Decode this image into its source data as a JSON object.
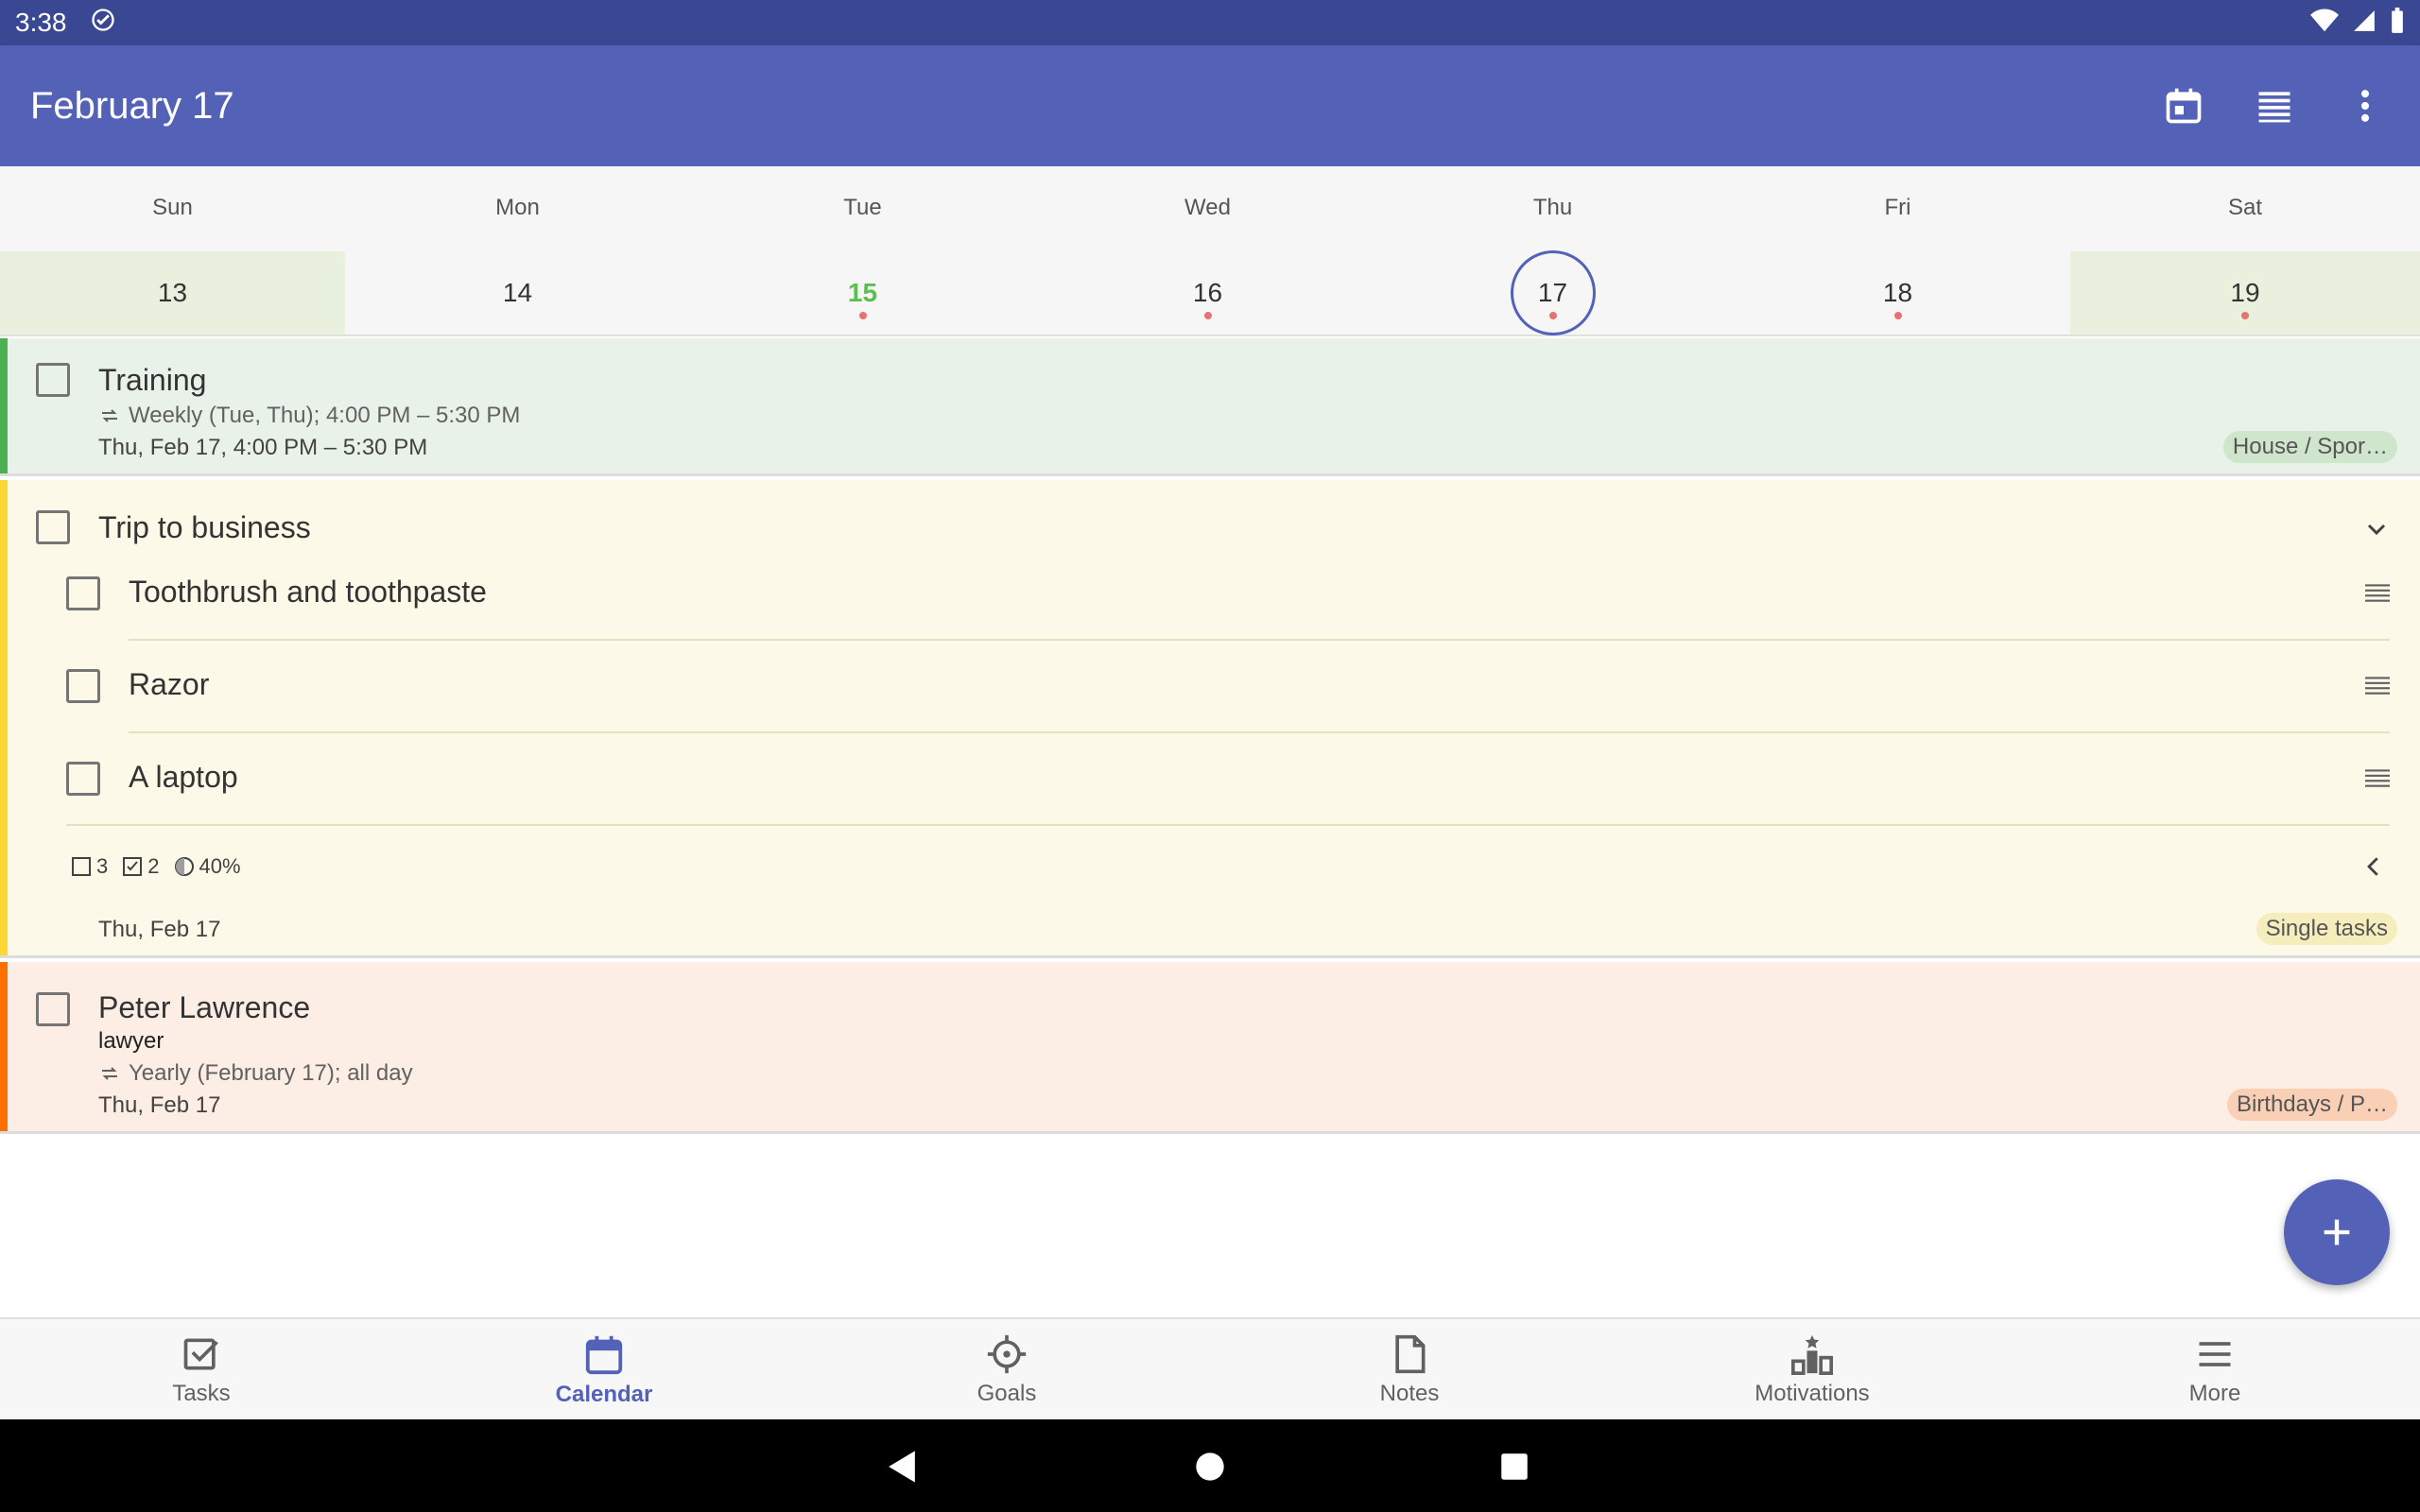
{
  "status_bar": {
    "time": "3:38"
  },
  "app_bar": {
    "title": "February 17"
  },
  "week": [
    {
      "name": "Sun",
      "num": "13",
      "weekend": true,
      "today": false,
      "selected": false,
      "dot": false
    },
    {
      "name": "Mon",
      "num": "14",
      "weekend": false,
      "today": false,
      "selected": false,
      "dot": false
    },
    {
      "name": "Tue",
      "num": "15",
      "weekend": false,
      "today": true,
      "selected": false,
      "dot": true
    },
    {
      "name": "Wed",
      "num": "16",
      "weekend": false,
      "today": false,
      "selected": false,
      "dot": true
    },
    {
      "name": "Thu",
      "num": "17",
      "weekend": false,
      "today": false,
      "selected": true,
      "dot": true
    },
    {
      "name": "Fri",
      "num": "18",
      "weekend": false,
      "today": false,
      "selected": false,
      "dot": true
    },
    {
      "name": "Sat",
      "num": "19",
      "weekend": true,
      "today": false,
      "selected": false,
      "dot": true
    }
  ],
  "tasks": {
    "training": {
      "title": "Training",
      "repeat": "Weekly (Tue, Thu); 4:00 PM – 5:30 PM",
      "date": "Thu, Feb 17, 4:00 PM – 5:30 PM",
      "tag": "House / Spor…"
    },
    "trip": {
      "title": "Trip to business",
      "subitems": [
        "Toothbrush and toothpaste",
        "Razor",
        "A laptop"
      ],
      "stats": {
        "open": "3",
        "done": "2",
        "progress": "40%"
      },
      "date": "Thu, Feb 17",
      "tag": "Single tasks"
    },
    "peter": {
      "title": "Peter Lawrence",
      "note": "lawyer",
      "repeat": "Yearly (February 17); all day",
      "date": "Thu, Feb 17",
      "tag": "Birthdays / P…"
    }
  },
  "bottom_nav": {
    "tasks": "Tasks",
    "calendar": "Calendar",
    "goals": "Goals",
    "notes": "Notes",
    "motivations": "Motivations",
    "more": "More"
  },
  "colors": {
    "primary": "#5361b7",
    "status_bar": "#3a4793",
    "training_accent": "#4caf50",
    "trip_accent": "#fdd835",
    "peter_accent": "#ff6f00"
  }
}
